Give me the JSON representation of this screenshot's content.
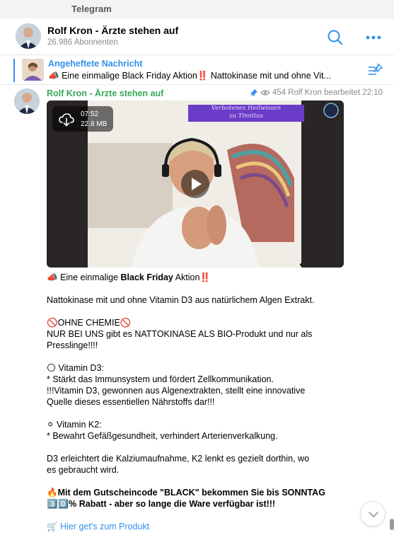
{
  "window": {
    "title": "Telegram"
  },
  "channel": {
    "name": "Rolf Kron - Ärzte stehen auf",
    "subscribers": "26.986 Abonnenten"
  },
  "pinned": {
    "title": "Angeheftete Nachricht",
    "emoji": "📣",
    "text": "Eine einmalige Black Friday Aktion",
    "emoji2": "‼️",
    "text2": "Nattokinase mit und ohne Vit..."
  },
  "message": {
    "sender": "Rolf Kron - Ärzte stehen auf",
    "views": "454",
    "author": "Rolf Kron",
    "edited_label": "bearbeitet",
    "time": "22:10",
    "video": {
      "duration": "07:52",
      "size": "22.8 MB",
      "banner_line1": "Verbotenes Heilwissen",
      "banner_line2": "zu Tinnitus"
    },
    "lines": {
      "l1_emoji": "📣",
      "l1_pre": "Eine einmalige ",
      "l1_bold": "Black Friday",
      "l1_post": " Aktion",
      "l1_emoji2": "‼️",
      "l2": "Nattokinase mit und ohne Vitamin D3 aus natürlichem Algen Extrakt.",
      "l3_emoji": "🚫",
      "l3_text": "OHNE CHEMIE",
      "l3_emoji2": "🚫",
      "l4": "NUR BEI UNS gibt es NATTOKINASE ALS BIO-Produkt und nur als",
      "l5": "Presslinge!!!!",
      "l6_emoji": "🌕",
      "l6_text": " Vitamin D3:",
      "l7": "* Stärkt das Immunsystem und fördert Zellkommunikation.",
      "l8": "!!!Vitamin D3, gewonnen aus Algenextrakten, stellt eine innovative",
      "l9": "Quelle dieses essentiellen Nährstoffs dar!!!",
      "l10_emoji": "⚪",
      "l10_text": " Vitamin K2:",
      "l11": "* Bewahrt Gefäßgesundheit, verhindert Arterienverkalkung.",
      "l12": "D3 erleichtert die Kalziumaufnahme, K2 lenkt es gezielt dorthin, wo",
      "l13": "es gebraucht wird.",
      "l14_emoji": "🔥",
      "l14_text": "Mit dem Gutscheincode \"BLACK\" bekommen Sie bis SONNTAG",
      "l15_emoji": "3️⃣0️⃣",
      "l15_text": "% Rabatt - aber so lange die Ware verfügbar ist!!!",
      "l16_emoji": "🛒",
      "l16_link": "Hier get's zum Produkt"
    }
  },
  "colors": {
    "accent": "#3390ec",
    "sender": "#3aa757",
    "muted": "#8a8a8a"
  },
  "icons": [
    "search-icon",
    "more-icon",
    "pinned-list-icon",
    "pin-icon",
    "eye-icon",
    "download-icon",
    "play-icon",
    "chevron-down-icon"
  ]
}
